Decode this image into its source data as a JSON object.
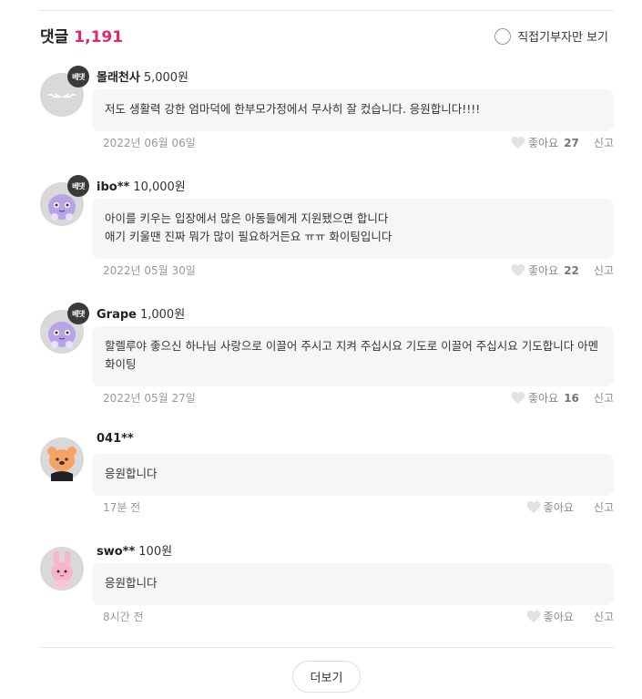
{
  "header": {
    "title": "댓글",
    "count": "1,191",
    "filter_label": "직접기부자만 보기"
  },
  "comments": [
    {
      "badge": "베댓",
      "author": "몰래천사",
      "amount": "5,000원",
      "text": "저도 생활력 강한 엄마덕에 한부모가정에서 무사히 잘 컸습니다. 응원합니다!!!!",
      "date": "2022년 06월 06일",
      "like_label": "좋아요",
      "likes": "27",
      "report": "신고",
      "avatar": "angel-wings-avatar"
    },
    {
      "badge": "베댓",
      "author": "ibo**",
      "amount": "10,000원",
      "text": "아이를 키우는 입장에서 많은 아동들에게 지원됐으면 합니다\n애기 키울땐 진짜 뭐가 많이 필요하거든요 ㅠㅠ 화이팅입니다",
      "date": "2022년 05월 30일",
      "like_label": "좋아요",
      "likes": "22",
      "report": "신고",
      "avatar": "purple-character-avatar"
    },
    {
      "badge": "베댓",
      "author": "Grape",
      "amount": "1,000원",
      "text": "할렐루야 좋으신 하나님 사랑으로 이끌어 주시고 지켜 주십시요 기도로 이끌어 주십시요 기도합니다 아멘 화이팅",
      "date": "2022년 05월 27일",
      "like_label": "좋아요",
      "likes": "16",
      "report": "신고",
      "avatar": "purple-character-avatar"
    },
    {
      "badge": "",
      "author": "041**",
      "amount": "",
      "text": "응원합니다",
      "date": "17분 전",
      "like_label": "좋아요",
      "likes": "",
      "report": "신고",
      "avatar": "orange-bear-avatar"
    },
    {
      "badge": "",
      "author": "swo**",
      "amount": "100원",
      "text": "응원합니다",
      "date": "8시간 전",
      "like_label": "좋아요",
      "likes": "",
      "report": "신고",
      "avatar": "pink-rabbit-avatar"
    }
  ],
  "more_button": "더보기"
}
